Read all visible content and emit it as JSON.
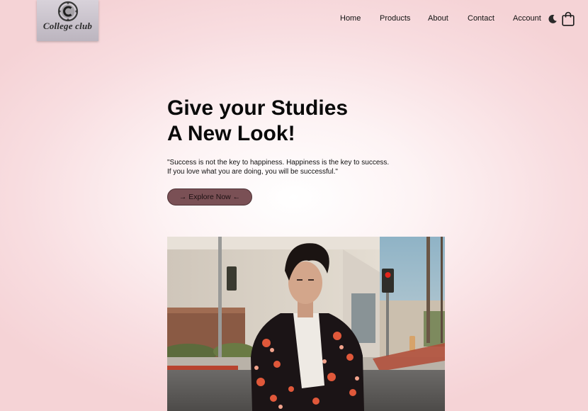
{
  "brand": {
    "logo_text": "College club"
  },
  "nav": {
    "items": [
      {
        "label": "Home"
      },
      {
        "label": "Products"
      },
      {
        "label": "About"
      },
      {
        "label": "Contact"
      },
      {
        "label": "Account"
      }
    ],
    "icons": [
      "moon-icon",
      "shopping-bag-icon"
    ]
  },
  "hero": {
    "headline_line1": "Give your Studies",
    "headline_line2": "A New Look!",
    "quote_line1": "\"Success is not the key to happiness. Happiness is the key to success.",
    "quote_line2": "If you love what you are doing, you will be successful.\"",
    "cta_label": "→ Explore Now ←"
  },
  "colors": {
    "background": "#f5d3d6",
    "button": "#7a5055",
    "text": "#0a0a0a"
  }
}
